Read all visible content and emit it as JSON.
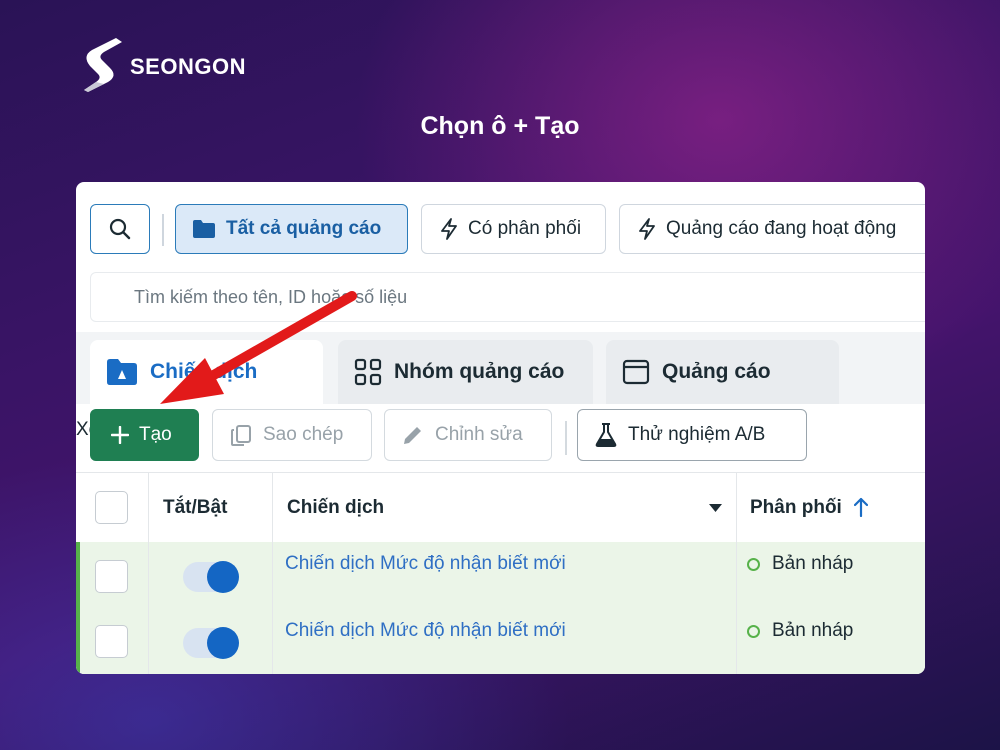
{
  "brand": {
    "name": "SEONGON"
  },
  "headline": "Chọn ô + Tạo",
  "filters": {
    "search_icon": "search-icon",
    "chips": [
      {
        "label": "Tất cả quảng cáo",
        "icon": "folder-icon",
        "selected": true
      },
      {
        "label": "Có phân phối",
        "icon": "lightning-icon",
        "selected": false
      },
      {
        "label": "Quảng cáo đang hoạt động",
        "icon": "lightning-icon",
        "selected": false
      }
    ],
    "search_placeholder": "Tìm kiếm theo tên, ID hoặc số liệu"
  },
  "tabs": [
    {
      "label": "Chiến dịch",
      "icon": "campaign-folder-icon",
      "active": true
    },
    {
      "label": "Nhóm quảng cáo",
      "icon": "grid-icon",
      "active": false
    },
    {
      "label": "Quảng cáo",
      "icon": "ad-window-icon",
      "active": false
    }
  ],
  "toolbar": {
    "create_label": "Tạo",
    "copy_label": "Sao chép",
    "edit_label": "Chỉnh sửa",
    "ab_test_label": "Thử nghiệm A/B",
    "more_label": "Xem thêm"
  },
  "table": {
    "headers": {
      "toggle": "Tắt/Bật",
      "campaign": "Chiến dịch",
      "delivery": "Phân phối"
    },
    "rows": [
      {
        "name": "Chiến dịch Mức độ nhận biết mới",
        "delivery": "Bản nháp",
        "enabled": true
      },
      {
        "name": "Chiến dịch Mức độ nhận biết mới",
        "delivery": "Bản nháp",
        "enabled": true
      }
    ]
  },
  "colors": {
    "accent_blue": "#1a6cc4",
    "create_green": "#1f7f52",
    "annotation_arrow": "#e21a1a",
    "status_green": "#57b24a"
  }
}
